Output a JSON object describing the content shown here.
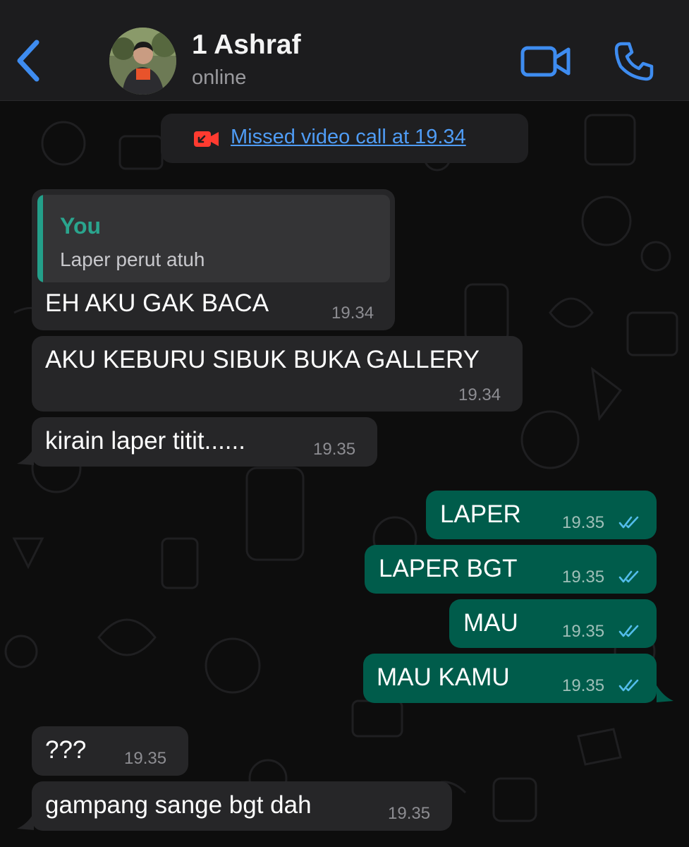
{
  "header": {
    "contact_name": "1 Ashraf",
    "status": "online",
    "back_icon": "chevron-left-icon",
    "video_icon": "video-camera-icon",
    "call_icon": "phone-icon",
    "accent_color": "#3e8cf0"
  },
  "system": {
    "missed_call_text": "Missed video call at 19.34",
    "missed_call_icon": "missed-video-call-icon",
    "missed_call_color": "#ff3b30"
  },
  "messages": [
    {
      "direction": "in",
      "quote_author": "You",
      "quote_text": "Laper perut atuh",
      "text": "EH AKU GAK BACA",
      "time": "19.34"
    },
    {
      "direction": "in",
      "text": "AKU KEBURU SIBUK BUKA GALLERY",
      "time": "19.34"
    },
    {
      "direction": "in",
      "text": "kirain laper titit......",
      "time": "19.35"
    },
    {
      "direction": "out",
      "text": "LAPER",
      "time": "19.35",
      "status": "read"
    },
    {
      "direction": "out",
      "text": "LAPER BGT",
      "time": "19.35",
      "status": "read"
    },
    {
      "direction": "out",
      "text": "MAU",
      "time": "19.35",
      "status": "read"
    },
    {
      "direction": "out",
      "text": "MAU KAMU",
      "time": "19.35",
      "status": "read"
    },
    {
      "direction": "in",
      "text": "???",
      "time": "19.35"
    },
    {
      "direction": "in",
      "text": "gampang sange bgt dah",
      "time": "19.35"
    }
  ],
  "colors": {
    "incoming_bubble": "#262628",
    "outgoing_bubble": "#005c4b",
    "quote_accent": "#2aa58e",
    "read_ticks": "#53bdeb"
  }
}
